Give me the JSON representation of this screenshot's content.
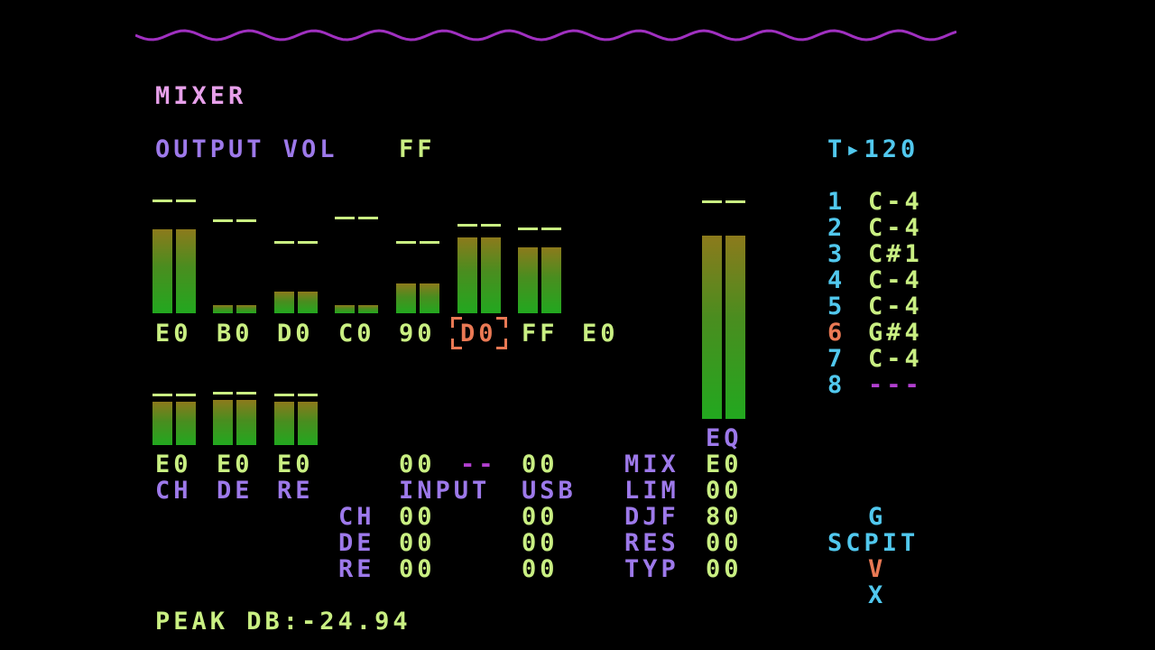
{
  "screen": {
    "title": "MIXER",
    "output_vol_label": "OUTPUT VOL",
    "output_vol_value": "FF",
    "tempo": "T▸120",
    "peak": "PEAK DB:-24.94"
  },
  "channel_bars": [
    {
      "level": 0.62,
      "peak": 0.79,
      "value": "E0"
    },
    {
      "level": 0.06,
      "peak": 0.64,
      "value": "B0"
    },
    {
      "level": 0.16,
      "peak": 0.48,
      "value": "D0"
    },
    {
      "level": 0.06,
      "peak": 0.66,
      "value": "C0"
    },
    {
      "level": 0.22,
      "peak": 0.48,
      "value": "90"
    },
    {
      "level": 0.56,
      "peak": 0.61,
      "value": "D0"
    },
    {
      "level": 0.49,
      "peak": 0.58,
      "value": "FF"
    },
    {
      "level": 0.0,
      "value": "E0"
    }
  ],
  "selected_channel_index": 5,
  "fx_bars": [
    {
      "level": 0.92,
      "peak": 0.95
    },
    {
      "level": 0.96,
      "peak": 0.98
    },
    {
      "level": 0.92,
      "peak": 0.95
    }
  ],
  "eq_bars": {
    "level": 0.78,
    "peak": 0.9,
    "label": "EQ"
  },
  "fx_values": [
    "E0",
    "E0",
    "E0"
  ],
  "fx_labels": [
    "CH",
    "DE",
    "RE"
  ],
  "input": {
    "top_left": "00",
    "dash": "--",
    "top_right": "00",
    "label": "INPUT",
    "usb_label": "USB",
    "rows": [
      {
        "label": "CH",
        "input": "00",
        "usb": "00"
      },
      {
        "label": "DE",
        "input": "00",
        "usb": "00"
      },
      {
        "label": "RE",
        "input": "00",
        "usb": "00"
      }
    ]
  },
  "master": [
    {
      "label": "MIX",
      "value": "E0"
    },
    {
      "label": "LIM",
      "value": "00"
    },
    {
      "label": "DJF",
      "value": "80"
    },
    {
      "label": "RES",
      "value": "00"
    },
    {
      "label": "TYP",
      "value": "00"
    }
  ],
  "tracks": [
    {
      "num": "1",
      "note": "C-4"
    },
    {
      "num": "2",
      "note": "C-4"
    },
    {
      "num": "3",
      "note": "C#1"
    },
    {
      "num": "4",
      "note": "C-4"
    },
    {
      "num": "5",
      "note": "C-4"
    },
    {
      "num": "6",
      "note": "G#4"
    },
    {
      "num": "7",
      "note": "C-4"
    },
    {
      "num": "8",
      "note": "---"
    }
  ],
  "nav_map": {
    "top": "G",
    "middle": "SCPIT",
    "below": "V",
    "bottom": "X"
  },
  "colors": {
    "background": "#000000",
    "label_purple": "#9d79ea",
    "title_pink": "#e7a0ea",
    "value_green": "#c9ef82",
    "info_cyan": "#51c8ee",
    "highlight_orange": "#ea7954",
    "wave_magenta": "#a030c0",
    "empty_magenta": "#b23fd0"
  }
}
